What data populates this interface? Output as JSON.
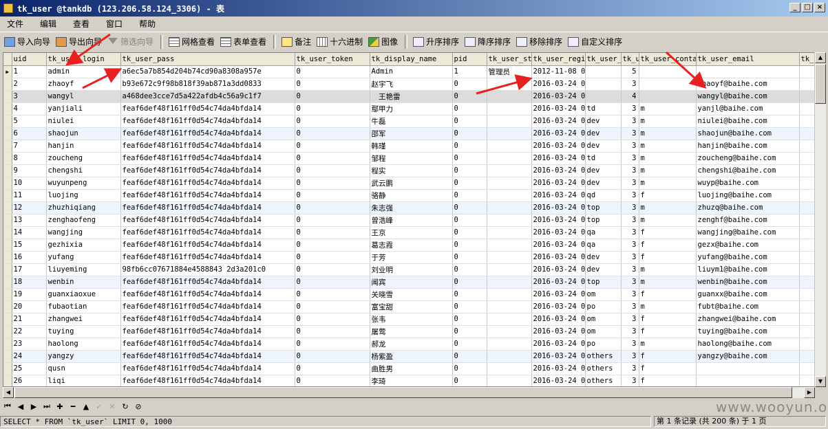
{
  "window": {
    "title": "tk_user @tankdb (123.206.58.124_3306) - 表",
    "minimize": "_",
    "maximize": "□",
    "close": "×"
  },
  "menu": [
    "文件",
    "编辑",
    "查看",
    "窗口",
    "帮助"
  ],
  "toolbar": [
    {
      "label": "导入向导",
      "icon": "import-icon",
      "name": "import-wizard-button",
      "enabled": true
    },
    {
      "label": "导出向导",
      "icon": "export-icon",
      "name": "export-wizard-button",
      "enabled": true
    },
    {
      "label": "筛选向导",
      "icon": "filter-icon",
      "name": "filter-wizard-button",
      "enabled": false
    },
    {
      "label": "网格查看",
      "icon": "grid-icon",
      "name": "grid-view-button",
      "enabled": true
    },
    {
      "label": "表单查看",
      "icon": "form-icon",
      "name": "form-view-button",
      "enabled": true
    },
    {
      "label": "备注",
      "icon": "memo-icon",
      "name": "memo-button",
      "enabled": true
    },
    {
      "label": "十六进制",
      "icon": "hex-icon",
      "name": "hex-button",
      "enabled": true
    },
    {
      "label": "图像",
      "icon": "image-icon",
      "name": "image-button",
      "enabled": true
    },
    {
      "label": "升序排序",
      "icon": "sort-asc-icon",
      "name": "sort-asc-button",
      "enabled": true
    },
    {
      "label": "降序排序",
      "icon": "sort-desc-icon",
      "name": "sort-desc-button",
      "enabled": true
    },
    {
      "label": "移除排序",
      "icon": "remove-sort-icon",
      "name": "remove-sort-button",
      "enabled": true
    },
    {
      "label": "自定义排序",
      "icon": "custom-sort-icon",
      "name": "custom-sort-button",
      "enabled": true
    }
  ],
  "grid": {
    "columns": [
      "uid",
      "tk_user_login",
      "tk_user_pass",
      "tk_user_token",
      "tk_display_name",
      "pid",
      "tk_user_st",
      "tk_user_regi",
      "tk_user_",
      "tk_u",
      "tk_user_conta",
      "tk_user_email",
      "tk_"
    ],
    "rows": [
      [
        "1",
        "admin",
        "a6ec5a7b854d204b74cd90a8308a957e",
        "0",
        "Admin",
        "1",
        "管理员",
        "2012-11-08 00",
        "",
        "5",
        "",
        "",
        ""
      ],
      [
        "2",
        "zhaoyf",
        "b93e672c9f98b818f39ab871a3dd0833",
        "0",
        "赵宇飞",
        "0",
        "",
        "2016-03-24 02",
        "",
        "3",
        "",
        "zhaoyf@baihe.com",
        ""
      ],
      [
        "3",
        "wangyl",
        "a468dee3cce7d5a422afdb4c56a9c1f7",
        "0",
        "　王艳雷",
        "0",
        "",
        "2016-03-24 02",
        "",
        "4",
        "",
        "wangyl@baihe.com",
        ""
      ],
      [
        "4",
        "yanjiali",
        "feaf6def48f161ff0d54c74da4bfda14",
        "0",
        "鄢甲力",
        "0",
        "",
        "2016-03-24 03",
        "td",
        "3",
        "m",
        "yanjl@baihe.com",
        ""
      ],
      [
        "5",
        "niulei",
        "feaf6def48f161ff0d54c74da4bfda14",
        "0",
        "牛磊",
        "0",
        "",
        "2016-03-24 06",
        "dev",
        "3",
        "m",
        "niulei@baihe.com",
        ""
      ],
      [
        "6",
        "shaojun",
        "feaf6def48f161ff0d54c74da4bfda14",
        "0",
        "邵军",
        "0",
        "",
        "2016-03-24 06",
        "dev",
        "3",
        "m",
        "shaojun@baihe.com",
        ""
      ],
      [
        "7",
        "hanjin",
        "feaf6def48f161ff0d54c74da4bfda14",
        "0",
        "韩瑾",
        "0",
        "",
        "2016-03-24 06",
        "dev",
        "3",
        "m",
        "hanjin@baihe.com",
        ""
      ],
      [
        "8",
        "zoucheng",
        "feaf6def48f161ff0d54c74da4bfda14",
        "0",
        "邹程",
        "0",
        "",
        "2016-03-24 06",
        "td",
        "3",
        "m",
        "zoucheng@baihe.com",
        ""
      ],
      [
        "9",
        "chengshi",
        "feaf6def48f161ff0d54c74da4bfda14",
        "0",
        "程实",
        "0",
        "",
        "2016-03-24 06",
        "dev",
        "3",
        "m",
        "chengshi@baihe.com",
        ""
      ],
      [
        "10",
        "wuyunpeng",
        "feaf6def48f161ff0d54c74da4bfda14",
        "0",
        "武云鹏",
        "0",
        "",
        "2016-03-24 06",
        "dev",
        "3",
        "m",
        "wuyp@baihe.com",
        ""
      ],
      [
        "11",
        "luojing",
        "feaf6def48f161ff0d54c74da4bfda14",
        "0",
        "骆静",
        "0",
        "",
        "2016-03-24 06",
        "qd",
        "3",
        "f",
        "luojing@baihe.com",
        ""
      ],
      [
        "12",
        "zhuzhiqiang",
        "feaf6def48f161ff0d54c74da4bfda14",
        "0",
        "朱志强",
        "0",
        "",
        "2016-03-24 06",
        "top",
        "3",
        "m",
        "zhuzq@baihe.com",
        ""
      ],
      [
        "13",
        "zenghaofeng",
        "feaf6def48f161ff0d54c74da4bfda14",
        "0",
        "曾浩峰",
        "0",
        "",
        "2016-03-24 06",
        "top",
        "3",
        "m",
        "zenghf@baihe.com",
        ""
      ],
      [
        "14",
        "wangjing",
        "feaf6def48f161ff0d54c74da4bfda14",
        "0",
        "王京",
        "0",
        "",
        "2016-03-24 06",
        "qa",
        "3",
        "f",
        "wangjing@baihe.com",
        ""
      ],
      [
        "15",
        "gezhixia",
        "feaf6def48f161ff0d54c74da4bfda14",
        "0",
        "葛志霞",
        "0",
        "",
        "2016-03-24 06",
        "qa",
        "3",
        "f",
        "gezx@baihe.com",
        ""
      ],
      [
        "16",
        "yufang",
        "feaf6def48f161ff0d54c74da4bfda14",
        "0",
        "于芳",
        "0",
        "",
        "2016-03-24 06",
        "dev",
        "3",
        "f",
        "yufang@baihe.com",
        ""
      ],
      [
        "17",
        "liuyeming",
        "98fb6cc07671884e4588843 2d3a201c0",
        "0",
        "刘业明",
        "0",
        "",
        "2016-03-24 06",
        "dev",
        "3",
        "m",
        "liuym1@baihe.com",
        ""
      ],
      [
        "18",
        "wenbin",
        "feaf6def48f161ff0d54c74da4bfda14",
        "0",
        "闻宾",
        "0",
        "",
        "2016-03-24 06",
        "top",
        "3",
        "m",
        "wenbin@baihe.com",
        ""
      ],
      [
        "19",
        "guanxiaoxue",
        "feaf6def48f161ff0d54c74da4bfda14",
        "0",
        "关晓雪",
        "0",
        "",
        "2016-03-24 06",
        "om",
        "3",
        "f",
        "guanxx@baihe.com",
        ""
      ],
      [
        "20",
        "fubaotian",
        "feaf6def48f161ff0d54c74da4bfda14",
        "0",
        "富宝甜",
        "0",
        "",
        "2016-03-24 06",
        "po",
        "3",
        "m",
        "fubt@baihe.com",
        ""
      ],
      [
        "21",
        "zhangwei",
        "feaf6def48f161ff0d54c74da4bfda14",
        "0",
        "张韦",
        "0",
        "",
        "2016-03-24 06",
        "om",
        "3",
        "f",
        "zhangwei@baihe.com",
        ""
      ],
      [
        "22",
        "tuying",
        "feaf6def48f161ff0d54c74da4bfda14",
        "0",
        "屠莺",
        "0",
        "",
        "2016-03-24 06",
        "om",
        "3",
        "f",
        "tuying@baihe.com",
        ""
      ],
      [
        "23",
        "haolong",
        "feaf6def48f161ff0d54c74da4bfda14",
        "0",
        "郝龙",
        "0",
        "",
        "2016-03-24 06",
        "po",
        "3",
        "m",
        "haolong@baihe.com",
        ""
      ],
      [
        "24",
        "yangzy",
        "feaf6def48f161ff0d54c74da4bfda14",
        "0",
        "杨紫盈",
        "0",
        "",
        "2016-03-24 06",
        "others",
        "3",
        "f",
        "yangzy@baihe.com",
        ""
      ],
      [
        "25",
        "qusn",
        "feaf6def48f161ff0d54c74da4bfda14",
        "0",
        "曲胜男",
        "0",
        "",
        "2016-03-24 06",
        "others",
        "3",
        "f",
        "",
        ""
      ],
      [
        "26",
        "liqi",
        "feaf6def48f161ff0d54c74da4bfda14",
        "0",
        "李琦",
        "0",
        "",
        "2016-03-24 06",
        "others",
        "3",
        "f",
        "",
        ""
      ]
    ]
  },
  "navigator": [
    "⏮",
    "◀",
    "▶",
    "⏭",
    "✚",
    "━",
    "▲",
    "✓",
    "✕",
    "↻",
    "⊘"
  ],
  "status": {
    "sql": "SELECT * FROM `tk_user` LIMIT 0, 1000",
    "records": "第 1 条记录 (共 200 条) 于 1 页"
  },
  "watermark": "www.wooyun.org"
}
